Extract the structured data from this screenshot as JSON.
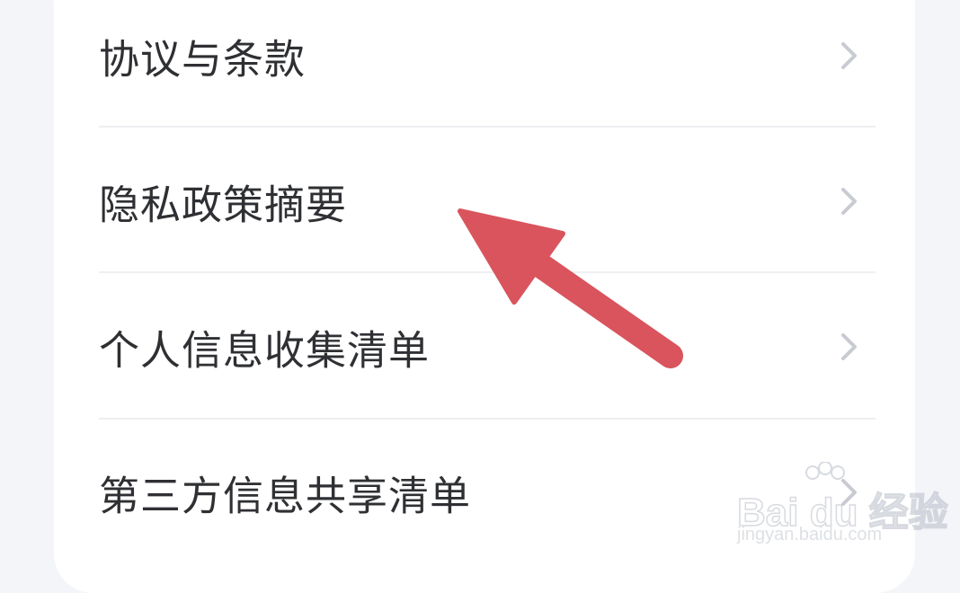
{
  "menu": {
    "items": [
      {
        "label": "协议与条款",
        "icon": "chevron-right-icon"
      },
      {
        "label": "隐私政策摘要",
        "icon": "chevron-right-icon"
      },
      {
        "label": "个人信息收集清单",
        "icon": "chevron-right-icon"
      },
      {
        "label": "第三方信息共享清单",
        "icon": "chevron-right-icon"
      }
    ]
  },
  "annotation": {
    "icon": "arrow-pointer-icon",
    "color": "#d9545c"
  },
  "watermark": {
    "brand": "Bai du 经验",
    "url": "jingyan.baidu.com"
  },
  "colors": {
    "background": "#f4f5f9",
    "card": "#ffffff",
    "text": "#2f3033",
    "chevron": "#c8cbd1",
    "divider": "#eeeff2"
  }
}
